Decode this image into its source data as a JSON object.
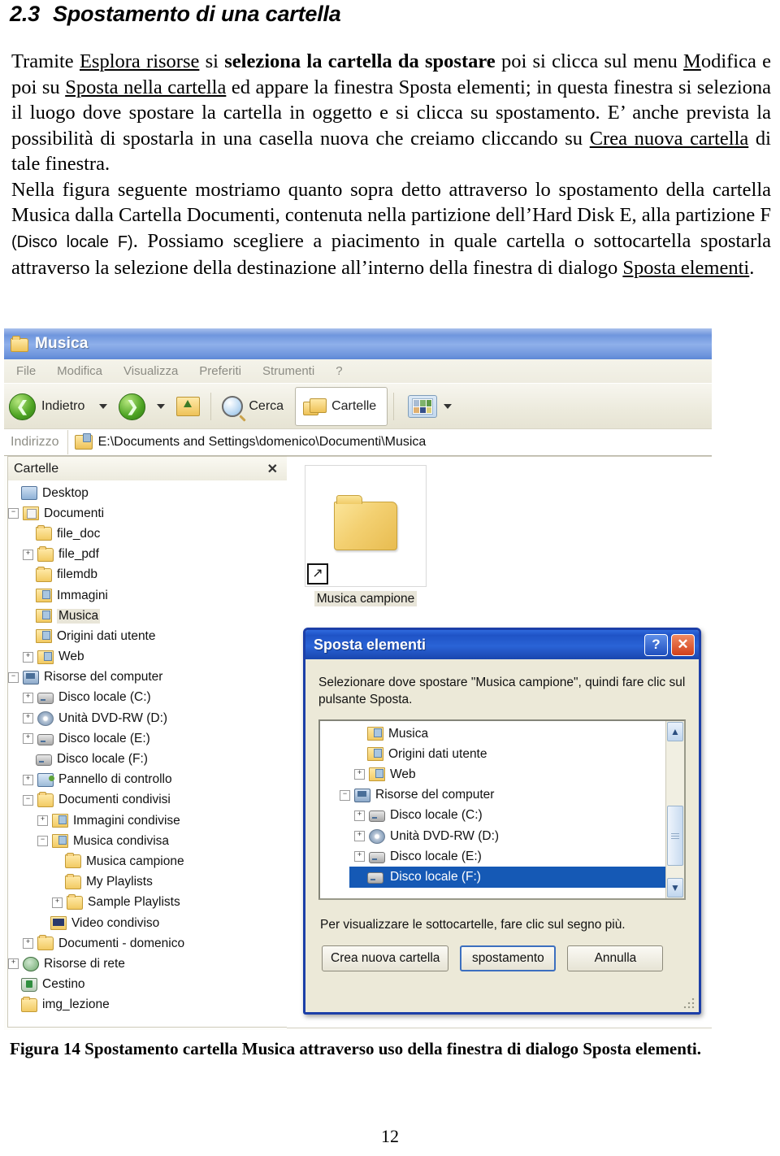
{
  "document": {
    "heading_number": "2.3",
    "heading_title": "Spostamento di una cartella",
    "paragraph1_parts": {
      "t1": "Tramite ",
      "u1": "Esplora risorse",
      "t2": " si ",
      "b1": "seleziona la cartella da spostare",
      "t3": " poi si clicca sul menu ",
      "u2": "M",
      "t4": "odifica e poi su ",
      "u3": "Sposta nella cartella",
      "t5": " ed appare la finestra Sposta elementi; in questa finestra si seleziona il luogo dove spostare la cartella in oggetto e si clicca su spostamento. E’ anche prevista la possibilità di spostarla in una casella nuova che creiamo cliccando su ",
      "u4": "Crea nuova cartella",
      "t6": " di tale finestra."
    },
    "paragraph2_parts": {
      "t1": "Nella figura seguente mostriamo quanto sopra detto attraverso lo spostamento della cartella Musica dalla Cartella Documenti, contenuta nella partizione dell’Hard Disk E, alla partizione F ",
      "m1": "(Disco locale F)",
      "t2": ". Possiamo scegliere a piacimento in quale cartella o sottocartella spostarla attraverso la selezione della destinazione all’interno della finestra di dialogo ",
      "u1": "Sposta elementi",
      "t3": "."
    },
    "figure_caption": "Figura 14 Spostamento cartella Musica attraverso uso della finestra di dialogo Sposta elementi.",
    "page_number": "12"
  },
  "explorer": {
    "title": "Musica",
    "title_icon": "folder-music-icon",
    "menu": [
      "File",
      "Modifica",
      "Visualizza",
      "Preferiti",
      "Strumenti",
      "?"
    ],
    "toolbar": {
      "back_label": "Indietro",
      "search_label": "Cerca",
      "folders_label": "Cartelle",
      "back_icon": "back-arrow-icon",
      "forward_icon": "forward-arrow-icon",
      "up_icon": "up-folder-icon",
      "search_icon": "magnifier-icon",
      "folders_icon": "folders-icon",
      "views_icon": "views-grid-icon"
    },
    "address": {
      "label": "Indirizzo",
      "value": "E:\\Documents and Settings\\domenico\\Documenti\\Musica",
      "icon": "address-folder-icon"
    },
    "folders_pane": {
      "title": "Cartelle",
      "close_label": "✕"
    },
    "tree": [
      {
        "label": "Desktop",
        "indent": 0,
        "expander": "",
        "icon": "desktop-icon",
        "selected": false
      },
      {
        "label": "Documenti",
        "indent": 0,
        "expander": "−",
        "icon": "documents-icon",
        "selected": false
      },
      {
        "label": "file_doc",
        "indent": 1,
        "expander": "",
        "icon": "folder-icon",
        "selected": false
      },
      {
        "label": "file_pdf",
        "indent": 1,
        "expander": "+",
        "icon": "folder-icon",
        "selected": false
      },
      {
        "label": "filemdb",
        "indent": 1,
        "expander": "",
        "icon": "folder-icon",
        "selected": false
      },
      {
        "label": "Immagini",
        "indent": 1,
        "expander": "",
        "icon": "pictures-folder-icon",
        "selected": false
      },
      {
        "label": "Musica",
        "indent": 1,
        "expander": "",
        "icon": "music-folder-icon",
        "selected": true
      },
      {
        "label": "Origini dati utente",
        "indent": 1,
        "expander": "",
        "icon": "datasource-folder-icon",
        "selected": false
      },
      {
        "label": "Web",
        "indent": 1,
        "expander": "+",
        "icon": "web-folder-icon",
        "selected": false
      },
      {
        "label": "Risorse del computer",
        "indent": 0,
        "expander": "−",
        "icon": "my-computer-icon",
        "selected": false
      },
      {
        "label": "Disco locale (C:)",
        "indent": 1,
        "expander": "+",
        "icon": "drive-icon",
        "selected": false
      },
      {
        "label": "Unità DVD-RW (D:)",
        "indent": 1,
        "expander": "+",
        "icon": "dvd-drive-icon",
        "selected": false
      },
      {
        "label": "Disco locale (E:)",
        "indent": 1,
        "expander": "+",
        "icon": "drive-icon",
        "selected": false
      },
      {
        "label": "Disco locale (F:)",
        "indent": 1,
        "expander": "",
        "icon": "drive-icon",
        "selected": false
      },
      {
        "label": "Pannello di controllo",
        "indent": 1,
        "expander": "+",
        "icon": "control-panel-icon",
        "selected": false
      },
      {
        "label": "Documenti condivisi",
        "indent": 1,
        "expander": "−",
        "icon": "folder-icon",
        "selected": false
      },
      {
        "label": "Immagini condivise",
        "indent": 2,
        "expander": "+",
        "icon": "pictures-folder-icon",
        "selected": false
      },
      {
        "label": "Musica condivisa",
        "indent": 2,
        "expander": "−",
        "icon": "music-folder-icon",
        "selected": false
      },
      {
        "label": "Musica campione",
        "indent": 3,
        "expander": "",
        "icon": "folder-icon",
        "selected": false
      },
      {
        "label": "My Playlists",
        "indent": 3,
        "expander": "",
        "icon": "folder-icon",
        "selected": false
      },
      {
        "label": "Sample Playlists",
        "indent": 3,
        "expander": "+",
        "icon": "folder-icon",
        "selected": false
      },
      {
        "label": "Video condiviso",
        "indent": 2,
        "expander": "",
        "icon": "video-folder-icon",
        "selected": false
      },
      {
        "label": "Documenti - domenico",
        "indent": 1,
        "expander": "+",
        "icon": "folder-icon",
        "selected": false
      },
      {
        "label": "Risorse di rete",
        "indent": 0,
        "expander": "+",
        "icon": "network-icon",
        "selected": false
      },
      {
        "label": "Cestino",
        "indent": 0,
        "expander": "",
        "icon": "recycle-bin-icon",
        "selected": false
      },
      {
        "label": "img_lezione",
        "indent": 0,
        "expander": "",
        "icon": "folder-icon",
        "selected": false
      }
    ],
    "content": {
      "item_label": "Musica campione",
      "item_icon": "large-folder-icon",
      "shortcut_badge": "↗"
    }
  },
  "dialog": {
    "title": "Sposta elementi",
    "help_button": "?",
    "close_button": "✕",
    "instruction": "Selezionare dove spostare \"Musica campione\", quindi fare clic sul pulsante Sposta.",
    "hint": "Per visualizzare le sottocartelle, fare clic sul segno più.",
    "tree": [
      {
        "label": "Musica",
        "indent": 2,
        "expander": "",
        "icon": "music-folder-icon",
        "selected": false
      },
      {
        "label": "Origini dati utente",
        "indent": 2,
        "expander": "",
        "icon": "datasource-folder-icon",
        "selected": false
      },
      {
        "label": "Web",
        "indent": 2,
        "expander": "+",
        "icon": "web-folder-icon",
        "selected": false
      },
      {
        "label": "Risorse del computer",
        "indent": 1,
        "expander": "−",
        "icon": "my-computer-icon",
        "selected": false
      },
      {
        "label": "Disco locale (C:)",
        "indent": 2,
        "expander": "+",
        "icon": "drive-icon",
        "selected": false
      },
      {
        "label": "Unità DVD-RW (D:)",
        "indent": 2,
        "expander": "+",
        "icon": "dvd-drive-icon",
        "selected": false
      },
      {
        "label": "Disco locale (E:)",
        "indent": 2,
        "expander": "+",
        "icon": "drive-icon",
        "selected": false
      },
      {
        "label": "Disco locale (F:)",
        "indent": 2,
        "expander": "",
        "icon": "drive-icon",
        "selected": true
      }
    ],
    "buttons": {
      "new_folder": "Crea nuova cartella",
      "move": "spostamento",
      "cancel": "Annulla"
    },
    "scroll_up_icon": "chevron-up-icon",
    "scroll_down_icon": "chevron-down-icon"
  },
  "colors": {
    "titlebar_blue": "#6f96dd",
    "dialog_blue": "#1f53c6",
    "selection_blue": "#1559b5",
    "folder_yellow": "#f2ca63",
    "chrome_beige": "#ece9d8"
  }
}
